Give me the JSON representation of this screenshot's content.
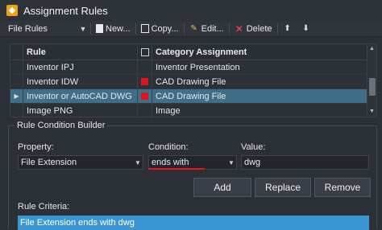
{
  "window": {
    "title": "Assignment Rules"
  },
  "toolbar": {
    "selector_label": "File Rules",
    "new_label": "New...",
    "copy_label": "Copy...",
    "edit_label": "Edit...",
    "delete_label": "Delete"
  },
  "grid": {
    "columns": {
      "rule": "Rule",
      "category": "Category Assignment"
    },
    "rows": [
      {
        "rule": "Inventor IPJ",
        "flag": false,
        "category": "Inventor Presentation"
      },
      {
        "rule": "Inventor IDW",
        "flag": true,
        "category": "CAD Drawing File"
      },
      {
        "rule": "Inventor or AutoCAD DWG",
        "flag": true,
        "category": "CAD Drawing File",
        "selected": true
      },
      {
        "rule": "Image PNG",
        "flag": false,
        "category": "Image"
      }
    ]
  },
  "builder": {
    "title": "Rule Condition Builder",
    "property_label": "Property:",
    "property_value": "File Extension",
    "condition_label": "Condition:",
    "condition_value": "ends with",
    "value_label": "Value:",
    "value_value": "dwg",
    "add_label": "Add",
    "replace_label": "Replace",
    "remove_label": "Remove",
    "criteria_label": "Rule Criteria:",
    "criteria_items": [
      "File Extension ends with dwg"
    ]
  },
  "colors": {
    "accent_selection": "#3e6e88",
    "criteria_highlight": "#3b96d1",
    "flag_red": "#e0141c"
  }
}
